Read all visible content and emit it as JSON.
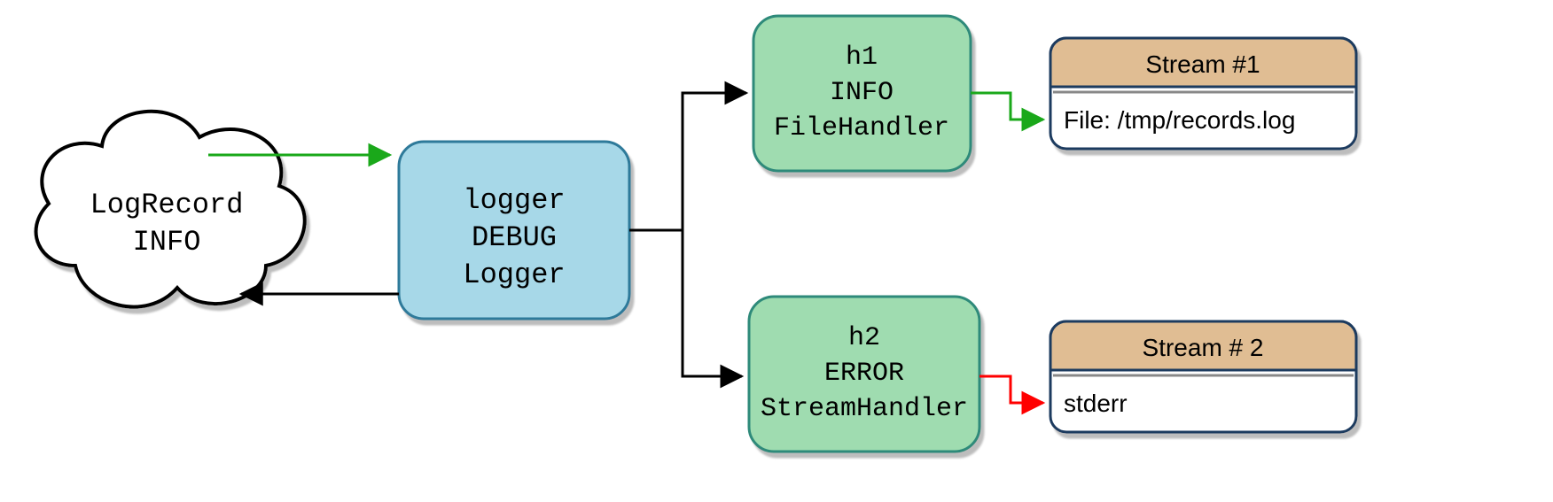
{
  "diagram": {
    "logrecord": {
      "line1": "LogRecord",
      "line2": "INFO"
    },
    "logger": {
      "line1": "logger",
      "line2": "DEBUG",
      "line3": "Logger"
    },
    "h1": {
      "line1": "h1",
      "line2": "INFO",
      "line3": "FileHandler"
    },
    "h2": {
      "line1": "h2",
      "line2": "ERROR",
      "line3": "StreamHandler"
    },
    "stream1": {
      "title": "Stream #1",
      "body": "File: /tmp/records.log"
    },
    "stream2": {
      "title": "Stream # 2",
      "body": "stderr"
    },
    "colors": {
      "cloud_fill": "#ffffff",
      "cloud_stroke": "#000000",
      "logger_fill": "#a7d8e8",
      "logger_stroke": "#2f7a9a",
      "handler_fill": "#9fdcb0",
      "handler_stroke": "#2f8a7a",
      "stream_title_fill": "#e0bd93",
      "stream_body_fill": "#ffffff",
      "stream_stroke": "#1d3a5f",
      "arrow_green": "#1aa81a",
      "arrow_red": "#ff0000",
      "arrow_black": "#000000",
      "shadow": "#bdbdbd"
    }
  }
}
